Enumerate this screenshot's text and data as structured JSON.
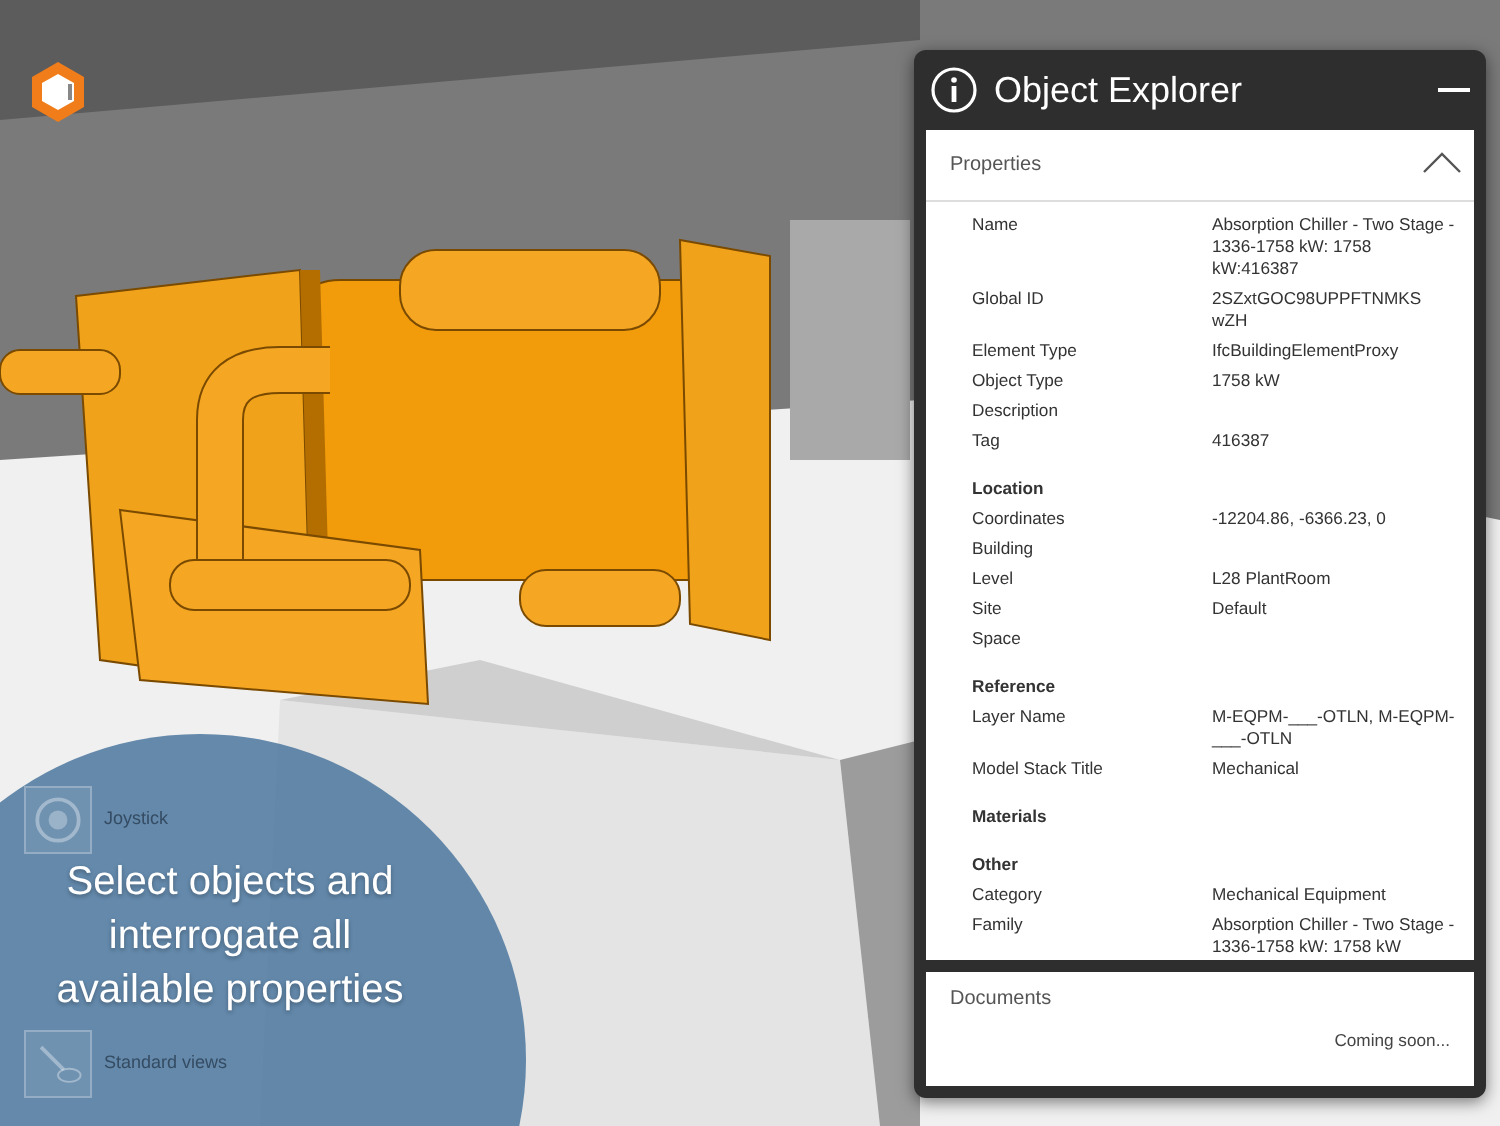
{
  "panel": {
    "title": "Object Explorer",
    "properties": {
      "title": "Properties",
      "expanded": true,
      "groups": [
        {
          "rows": [
            {
              "label": "Name",
              "value": "Absorption Chiller - Two Stage - 1336-1758 kW: 1758 kW:416387"
            },
            {
              "label": "Global ID",
              "value": "2SZxtGOC98UPPFTNMKS wZH"
            },
            {
              "label": "Element Type",
              "value": "IfcBuildingElementProxy"
            },
            {
              "label": "Object Type",
              "value": "1758 kW"
            },
            {
              "label": "Description"
            },
            {
              "label": "Tag",
              "value": "416387"
            }
          ]
        },
        {
          "heading": "Location",
          "rows": [
            {
              "label": "Coordinates",
              "value": "-12204.86, -6366.23, 0"
            },
            {
              "label": "Building"
            },
            {
              "label": "Level",
              "value": "L28 PlantRoom"
            },
            {
              "label": "Site",
              "value": "Default"
            },
            {
              "label": "Space"
            }
          ]
        },
        {
          "heading": "Reference",
          "rows": [
            {
              "label": "Layer Name",
              "value": "M-EQPM-___-OTLN, M-EQPM-___-OTLN"
            },
            {
              "label": "Model Stack Title",
              "value": "Mechanical"
            }
          ]
        },
        {
          "heading": "Materials"
        },
        {
          "heading": "Other",
          "rows": [
            {
              "label": "Category",
              "value": "Mechanical Equipment"
            },
            {
              "label": "Family",
              "value": "Absorption Chiller - Two Stage - 1336-1758 kW: 1758 kW"
            }
          ]
        }
      ]
    },
    "documents": {
      "title": "Documents",
      "note": "Coming soon..."
    }
  },
  "tools": [
    {
      "label": "Joystick",
      "kind": "joystick"
    },
    {
      "label": "Standard views",
      "kind": "views"
    }
  ],
  "callout": "Select objects and interrogate all available properties"
}
